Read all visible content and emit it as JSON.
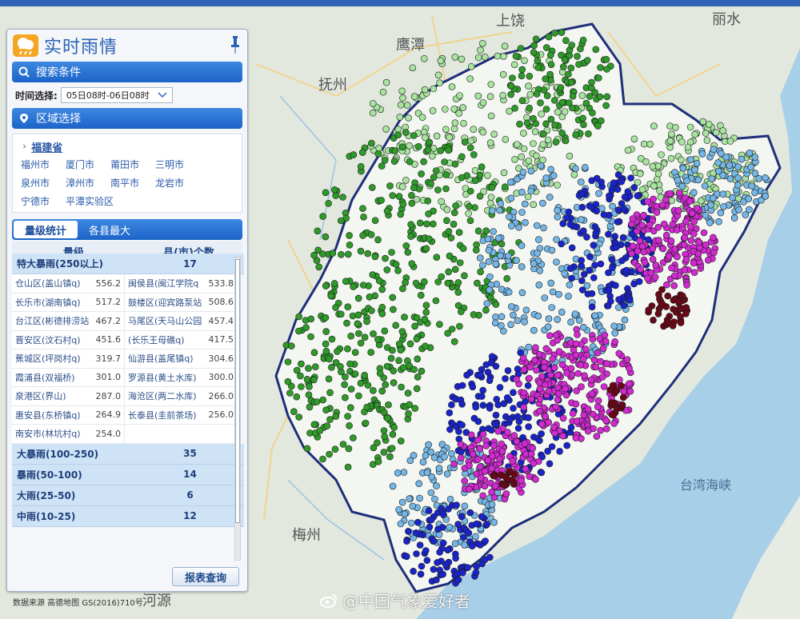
{
  "panel": {
    "title": "实时雨情",
    "search_header": "搜索条件",
    "time_label": "时间选择:",
    "time_value": "05日08时-06日08时",
    "region_header": "区域选择",
    "province": "福建省",
    "cities": [
      "福州市",
      "厦门市",
      "莆田市",
      "三明市",
      "泉州市",
      "漳州市",
      "南平市",
      "龙岩市",
      "宁德市",
      "平潭实验区"
    ],
    "tabs": [
      "量级统计",
      "各县最大"
    ],
    "table_headers": [
      "量级",
      "县(市)个数"
    ],
    "categories": [
      {
        "name": "特大暴雨(250以上)",
        "count": "17"
      },
      {
        "name": "大暴雨(100-250)",
        "count": "35"
      },
      {
        "name": "暴雨(50-100)",
        "count": "14"
      },
      {
        "name": "大雨(25-50)",
        "count": "6"
      },
      {
        "name": "中雨(10-25)",
        "count": "12"
      }
    ],
    "stations": [
      {
        "name": "仓山区(盖山镇q)",
        "value": "556.2"
      },
      {
        "name": "闽侯县(闽江学院q",
        "value": "533.8"
      },
      {
        "name": "长乐市(湖南镇q)",
        "value": "517.2"
      },
      {
        "name": "鼓楼区(迎宾路泵站",
        "value": "508.6"
      },
      {
        "name": "台江区(彬德排涝站",
        "value": "467.2"
      },
      {
        "name": "马尾区(天马山公园",
        "value": "457.4"
      },
      {
        "name": "晋安区(汶石村q)",
        "value": "451.6"
      },
      {
        "name": "(长乐王母礁q)",
        "value": "417.5"
      },
      {
        "name": "蕉城区(坪岗村q)",
        "value": "319.7"
      },
      {
        "name": "仙游县(盖尾镇q)",
        "value": "304.6"
      },
      {
        "name": "霞浦县(双福桥)",
        "value": "301.0"
      },
      {
        "name": "罗源县(黄土水库)",
        "value": "300.0"
      },
      {
        "name": "泉港区(界山)",
        "value": "287.0"
      },
      {
        "name": "海沧区(两二水库)",
        "value": "266.0"
      },
      {
        "name": "惠安县(东桥镇q)",
        "value": "264.9"
      },
      {
        "name": "长泰县(圭前茶场)",
        "value": "256.0"
      },
      {
        "name": "南安市(林坑村q)",
        "value": "254.0"
      }
    ],
    "report_button": "报表查询"
  },
  "map": {
    "cities": [
      "上饶",
      "鹰潭",
      "抚州",
      "丽水",
      "梅州",
      "河源",
      "台湾海峡"
    ],
    "partial_labels": [
      "南",
      "平",
      "宁",
      "三",
      "明",
      "龙",
      "岩",
      "门",
      "泉"
    ],
    "rain_colors": {
      "medium": "#a8e3a0",
      "heavy": "#2f9a2a",
      "storm": "#74b6e6",
      "heavy_storm": "#1a24c9",
      "severe": "#d12ad1",
      "extreme": "#6b0818"
    }
  },
  "footer": {
    "credit": "数据来源 高德地图 GS(2016)710号",
    "watermark": "@中国气象爱好者"
  }
}
